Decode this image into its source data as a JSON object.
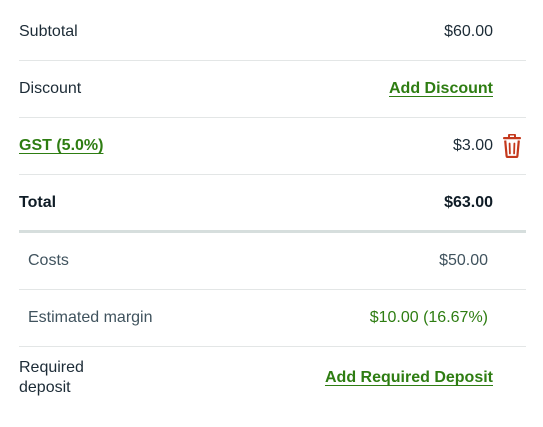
{
  "summary": {
    "subtotal": {
      "label": "Subtotal",
      "value": "$60.00"
    },
    "discount": {
      "label": "Discount",
      "action": "Add Discount"
    },
    "gst": {
      "label": "GST (5.0%)",
      "value": "$3.00",
      "delete_icon": "trash-icon"
    },
    "total": {
      "label": "Total",
      "value": "$63.00"
    },
    "costs": {
      "label": "Costs",
      "value": "$50.00"
    },
    "margin": {
      "label": "Estimated margin",
      "value": "$10.00 (16.67%)"
    },
    "deposit": {
      "label": "Required deposit",
      "action": "Add Required Deposit"
    }
  },
  "colors": {
    "accent_green": "#2e7d12",
    "danger_red": "#c4391d",
    "text_dark": "#1c2b36",
    "text_muted": "#40535e"
  }
}
